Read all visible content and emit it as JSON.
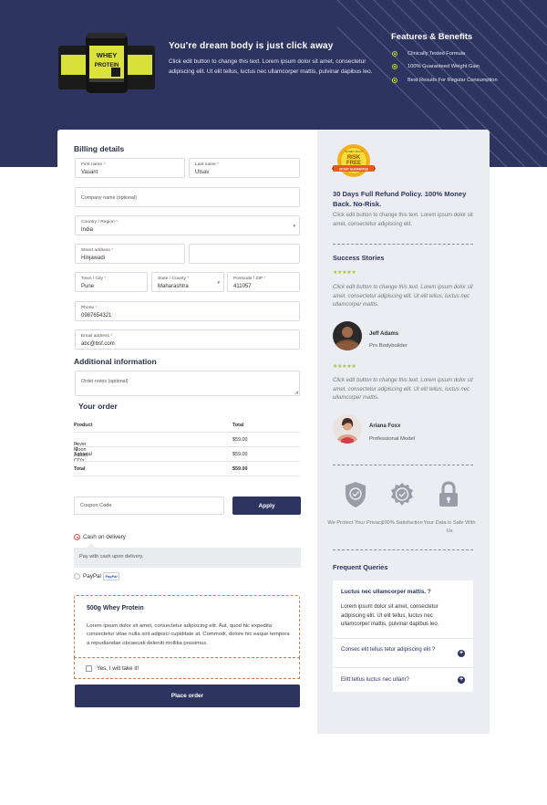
{
  "hero": {
    "title": "You're dream body is just click away",
    "text": "Click edit button to change this text. Lorem ipsum dolor sit amet, consectetur adipiscing elit. Ut elit tellus, luctus nec ullamcorper mattis, pulvinar dapibus leo.",
    "product_label_1": "WHEY",
    "product_label_2": "PROTEIN",
    "features_title": "Features & Benefits",
    "features": [
      "Clinically Tested Formula",
      "100% Guaranteed Weight Gain",
      "Best Results For Regular Consumption"
    ]
  },
  "billing": {
    "heading": "Billing details",
    "first_name": {
      "label": "First name",
      "value": "Vasant"
    },
    "last_name": {
      "label": "Last name",
      "value": "Utsav"
    },
    "company": {
      "placeholder": "Company name (optional)"
    },
    "country": {
      "label": "Country / Region",
      "value": "India"
    },
    "street": {
      "label": "Street address",
      "value": "Hinjawadi"
    },
    "city": {
      "label": "Town / City",
      "value": "Pune"
    },
    "state": {
      "label": "State / County",
      "value": "Maharashtra"
    },
    "postcode": {
      "label": "Postcode / ZIP",
      "value": "411057"
    },
    "phone": {
      "label": "Phone",
      "value": "0987654321"
    },
    "email": {
      "label": "Email address",
      "value": "abc@bsf.com"
    },
    "required_mark": "*"
  },
  "additional": {
    "heading": "Additional information",
    "notes_placeholder": "Order notes (optional)"
  },
  "order": {
    "heading": "Your order",
    "col_product": "Product",
    "col_total": "Total",
    "item_name": "Fever Moon Album CD's",
    "item_qty": "× 1",
    "item_total": "$59.00",
    "subtotal_label": "Subtotal",
    "subtotal": "$59.00",
    "total_label": "Total",
    "total": "$59.00"
  },
  "coupon": {
    "placeholder": "Coupon Code",
    "apply_label": "Apply"
  },
  "payment": {
    "cod_label": "Cash on delivery",
    "cod_description": "Pay with cash upon delivery.",
    "paypal_label": "PayPal",
    "paypal_badge": "PayPal",
    "selected": "cod"
  },
  "order_bump": {
    "title": "500g Whey Protein",
    "text": "Lorem ipsum dolor sit amet, consectetur adipiscing elit. Aut, quod hic expedita consectetur vitae nulla sint adipisci cupiditate at. Commodi, dolore hic eaque tempora a repudiandae obcaecati deleniti mollitia possimus.",
    "checkbox_label": "Yes, I will take it!"
  },
  "place_order_label": "Place order",
  "sidebar": {
    "badge_top": "MONEY BACK",
    "badge_mid_1": "RISK",
    "badge_mid_2": "FREE",
    "badge_ribbon": "30 DAY GUARANTEE",
    "refund_title": "30 Days Full Refund Policy. 100% Money Back. No-Risk.",
    "refund_text": "Click edit button to change this text. Lorem ipsum dolor sit amet, consectetur adipiscing elit.",
    "stories_heading": "Success Stories",
    "stars": "★★★★★",
    "testimonials": [
      {
        "text": "Click edit button to change this text. Lorem ipsum dolor sit amet, consectetur adipiscing elit. Ut elit tellus, luctus nec ullamcorper mattis.",
        "name": "Jeff Adams",
        "role": "Pro Bodybuilder"
      },
      {
        "text": "Click edit button to change this text. Lorem ipsum dolor sit amet, consectetur adipiscing elit. Ut elit tellus, luctus nec ullamcorper mattis.",
        "name": "Ariana Foxx",
        "role": "Professional Model"
      }
    ],
    "trust": [
      {
        "label": "We Protect Your Privacy",
        "icon": "shield-check-icon"
      },
      {
        "label": "100% Satisfaction",
        "icon": "badge-check-icon"
      },
      {
        "label": "Your Data is Safe With Us",
        "icon": "lock-icon"
      }
    ],
    "faq_heading": "Frequent Queries",
    "faq": [
      {
        "q": "Luctus nec ullamcorper mattis. ?",
        "a": "Lorem ipsum dolor sit amet, consectetur adipiscing elit. Ut elit tellus, luctus nec ullamcorper mattis, pulvinar dapibus leo."
      },
      {
        "q": "Consec elit tellus tetur adipiscing elit ?"
      },
      {
        "q": "Elitt tellus luctus nec ullam?"
      }
    ],
    "faq_toggle": "+"
  },
  "colors": {
    "navy": "#2d3460",
    "accent": "#c4d52e",
    "highlight": "#e3773f",
    "star": "#a6c92a"
  }
}
